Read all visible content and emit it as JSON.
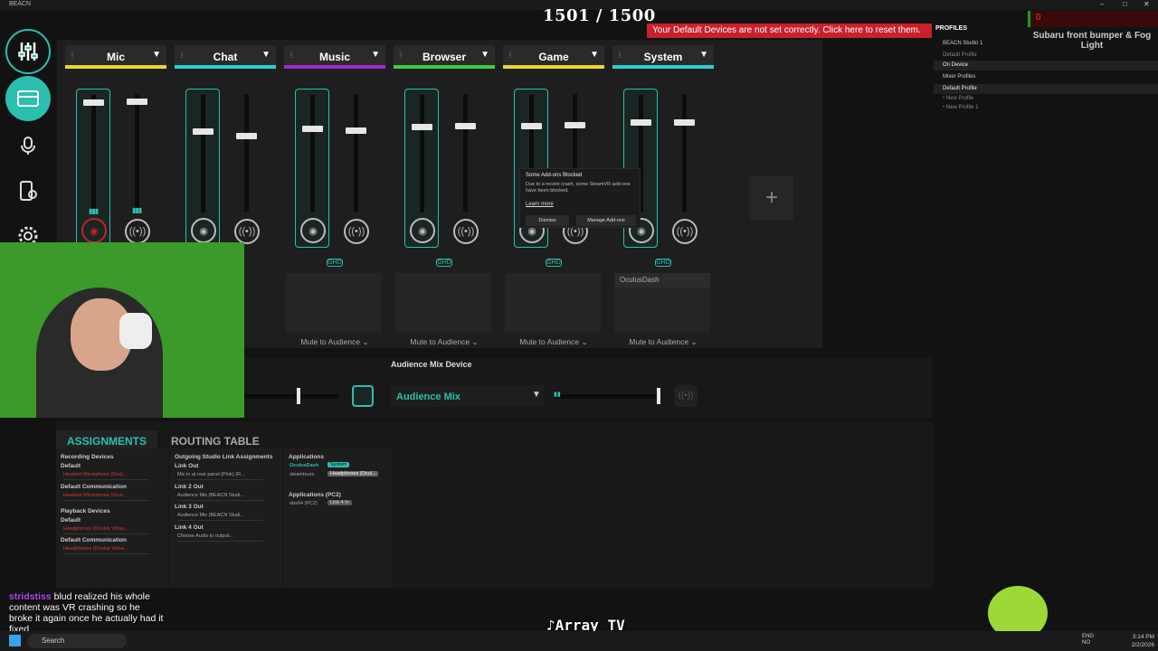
{
  "window": {
    "title": "BEACN"
  },
  "counter": "1501 / 1500",
  "warning": "Your Default Devices are not set correctly. Click here to reset them.",
  "channels": [
    {
      "name": "Mic",
      "color": "#e8d62b",
      "left_level": 0.96,
      "right_level": 0.96,
      "muted": true
    },
    {
      "name": "Chat",
      "color": "#2bd0d0",
      "left_level": 0.7,
      "right_level": 0.65
    },
    {
      "name": "Music",
      "color": "#9b2bd0",
      "left_level": 0.72,
      "right_level": 0.7
    },
    {
      "name": "Browser",
      "color": "#3bd03b",
      "left_level": 0.74,
      "right_level": 0.74
    },
    {
      "name": "Game",
      "color": "#e8d62b",
      "left_level": 0.75,
      "right_level": 0.75
    },
    {
      "name": "System",
      "color": "#2bd0d0",
      "left_level": 0.78,
      "right_level": 0.77
    }
  ],
  "link_label": "GHD",
  "mute_to_audience": "Mute to Audience",
  "system_app": "OculusDash",
  "audience_mix": {
    "label": "Audience Mix Device",
    "name": "Audience Mix",
    "level": 1.0
  },
  "toast": {
    "title": "Some Add-ons Blocked",
    "body": "Due to a recent crash, some SteamVR add-ons have been blocked.",
    "link": "Learn more",
    "dismiss": "Dismiss",
    "manage": "Manage Add-ons"
  },
  "assignments": {
    "tab_active": "ASSIGNMENTS",
    "tab_other": "ROUTING TABLE",
    "recording_devices": "Recording Devices",
    "default": "Default",
    "rec_default_val": "Headset Microphone (Ocul...",
    "default_comm": "Default Communication",
    "rec_comm_val": "Headset Microphone (Ocul...",
    "playback_devices": "Playback Devices",
    "pb_default_val": "Headphones (Oculus Virtua...",
    "pb_comm_val": "Headphones (Oculus Virtua...",
    "outgoing": "Outgoing Studio Link Assignments",
    "link_out": "Link Out",
    "link_out_val": "Mic in at rear panel (Pink) (R...",
    "link2": "Link 2 Out",
    "link2_val": "Audience Mix (BEACN Studi...",
    "link3": "Link 3 Out",
    "link3_val": "Audience Mix (BEACN Studi...",
    "link4": "Link 4 Out",
    "link4_val": "Choose Audio to output...",
    "applications": "Applications",
    "app1": "OculusDash",
    "app1_tag": "System",
    "app2": "steamtours",
    "app2_tag": "Headphones (Ocul...",
    "applications_pc2": "Applications (PC2)",
    "app3": "obs64 (PC2)",
    "app3_tag": "Link 4 In"
  },
  "profiles": {
    "header": "PROFILES",
    "device": "BEACN Studio 1",
    "default_profile": "Default Profile",
    "on_device": "On Device",
    "mixer_profiles": "Mixer Profiles",
    "mp_default": "Default Profile",
    "new_profile": "New Profile",
    "new_profile1": "New Profile 1"
  },
  "overlay": {
    "value": "0",
    "game_title": "Subaru front bumper & Fog Light"
  },
  "chat": {
    "user": "stridstiss",
    "message": "blud realized his whole content was VR crashing so he broke it again once he actually had it fixed"
  },
  "handle": "Array_TV",
  "taskbar": {
    "search": "Search",
    "lang": "ENG NO",
    "time": "3:14 PM",
    "date": "2/2/2026"
  }
}
